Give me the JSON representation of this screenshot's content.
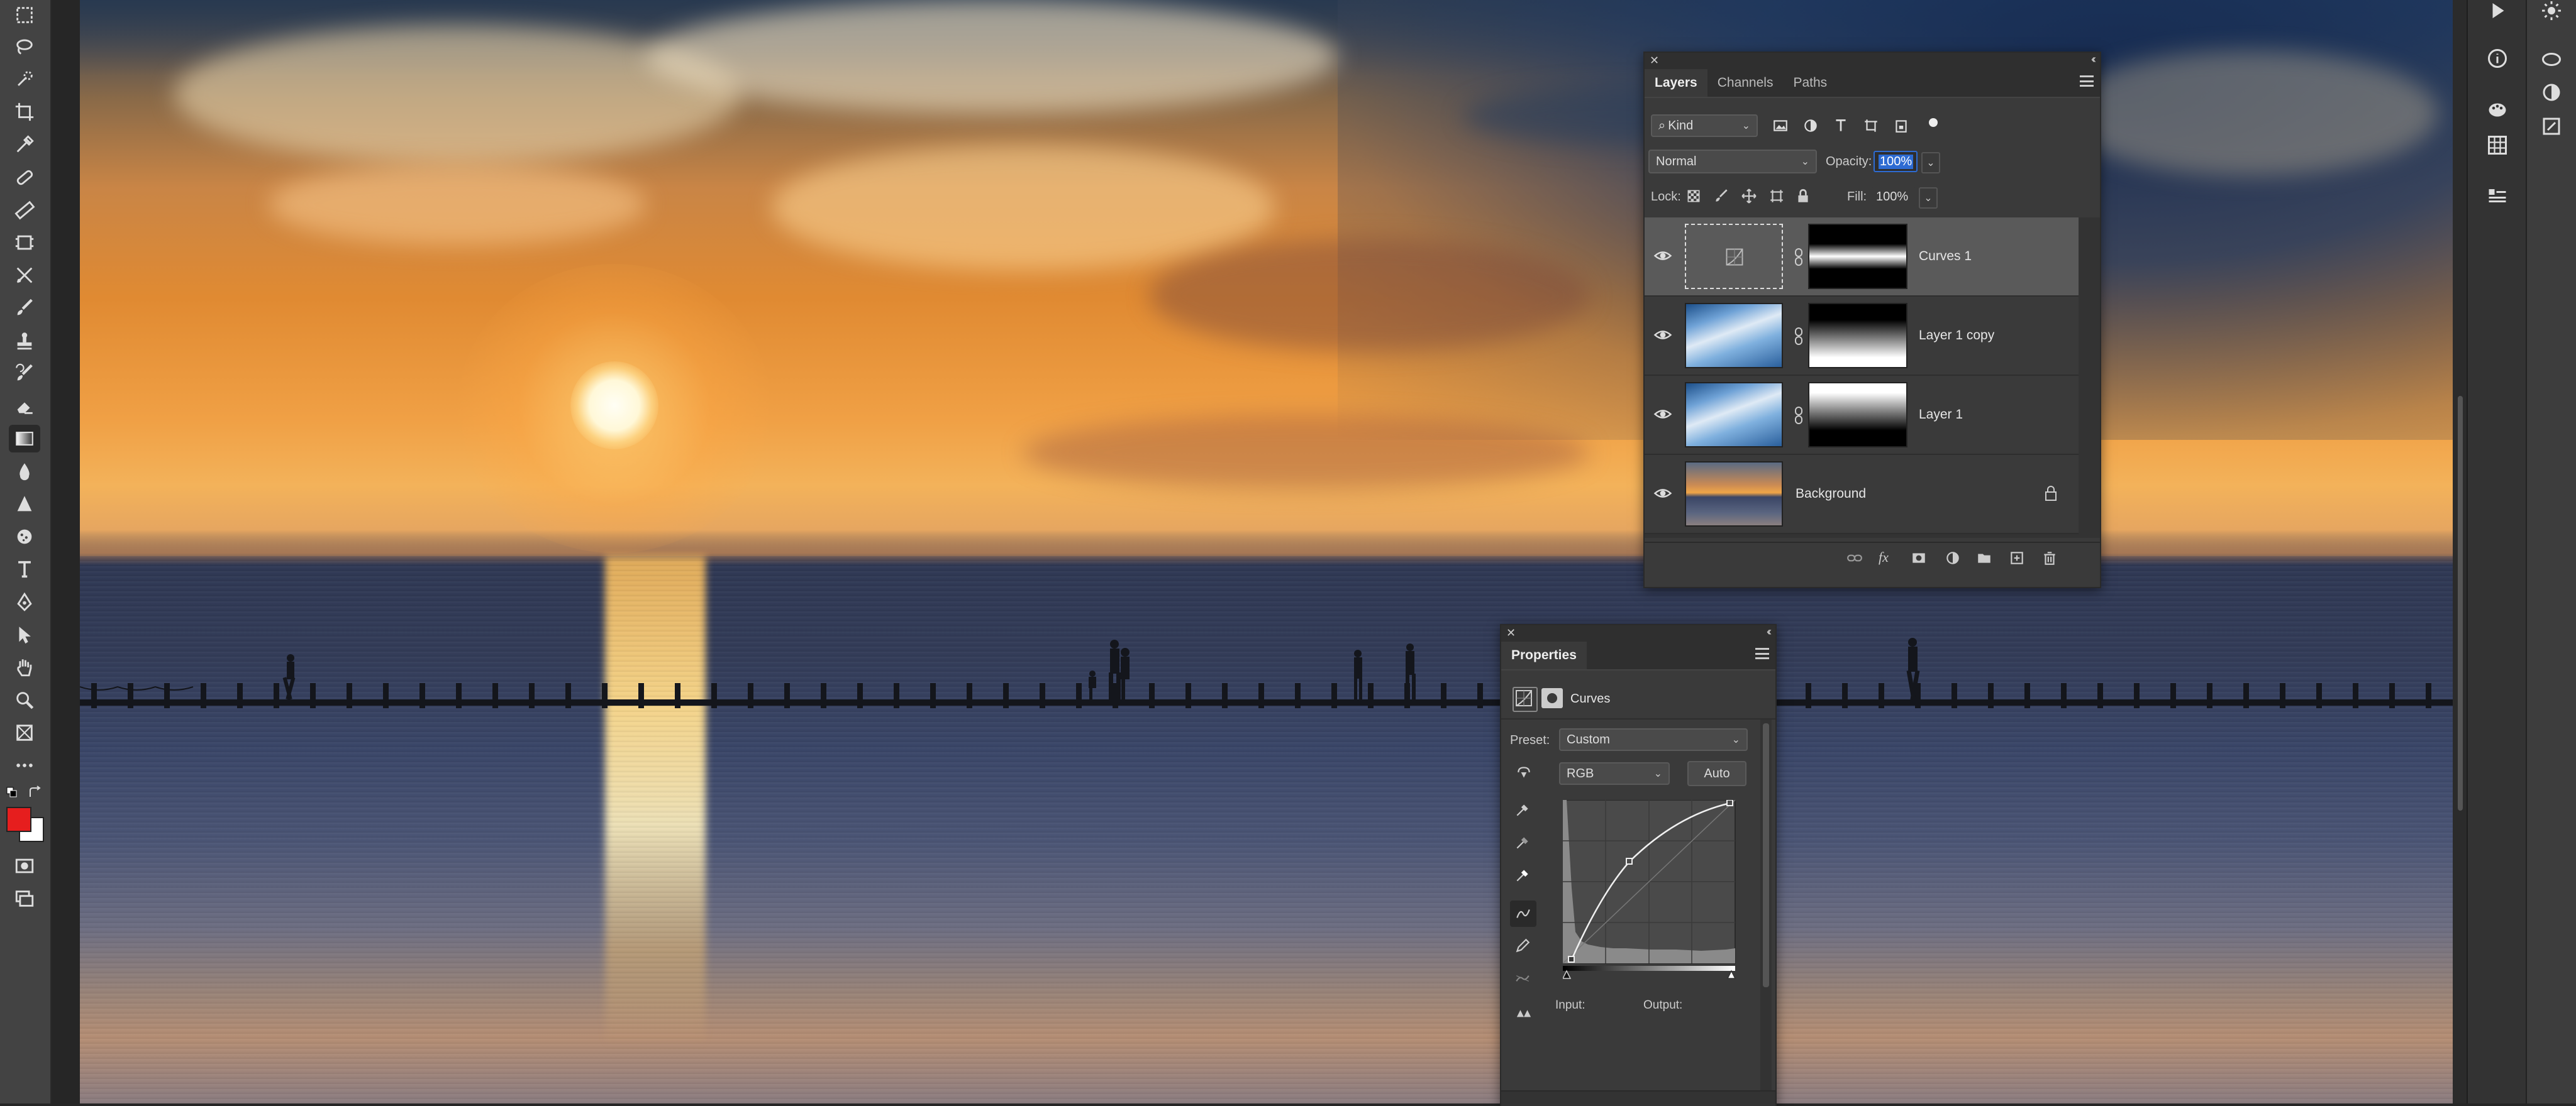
{
  "toolbar": {
    "tools": [
      "marquee-icon",
      "lasso-icon",
      "quick-select-icon",
      "crop-icon",
      "eyedropper-icon",
      "spot-heal-icon",
      "brush-icon",
      "clone-stamp-icon",
      "history-brush-icon",
      "eraser-icon",
      "gradient-icon",
      "blur-icon",
      "dodge-icon",
      "pen-icon",
      "type-icon",
      "path-select-icon",
      "shape-icon",
      "hand-icon",
      "zoom-icon",
      "frame-icon",
      "more-icon"
    ],
    "foreground_color": "#e61e1e",
    "background_color": "#ffffff"
  },
  "layers_panel": {
    "tabs": [
      "Layers",
      "Channels",
      "Paths"
    ],
    "active_tab": "Layers",
    "filter_kind": "Kind",
    "blend_mode": "Normal",
    "opacity_label": "Opacity:",
    "opacity_value": "100%",
    "lock_label": "Lock:",
    "fill_label": "Fill:",
    "fill_value": "100%",
    "layers": [
      {
        "name": "Curves 1",
        "selected": true
      },
      {
        "name": "Layer 1 copy",
        "selected": false
      },
      {
        "name": "Layer 1",
        "selected": false
      },
      {
        "name": "Background",
        "selected": false,
        "locked": true
      }
    ]
  },
  "properties_panel": {
    "title": "Properties",
    "adjustment_name": "Curves",
    "preset_label": "Preset:",
    "preset_value": "Custom",
    "channel_value": "RGB",
    "auto_label": "Auto",
    "input_label": "Input:",
    "output_label": "Output:"
  },
  "colors": {
    "ui_dark": "#262626",
    "panel_bg": "#3a3a3a",
    "selected_layer": "#5a5a5a",
    "accent_blue": "#2d6bd2"
  }
}
